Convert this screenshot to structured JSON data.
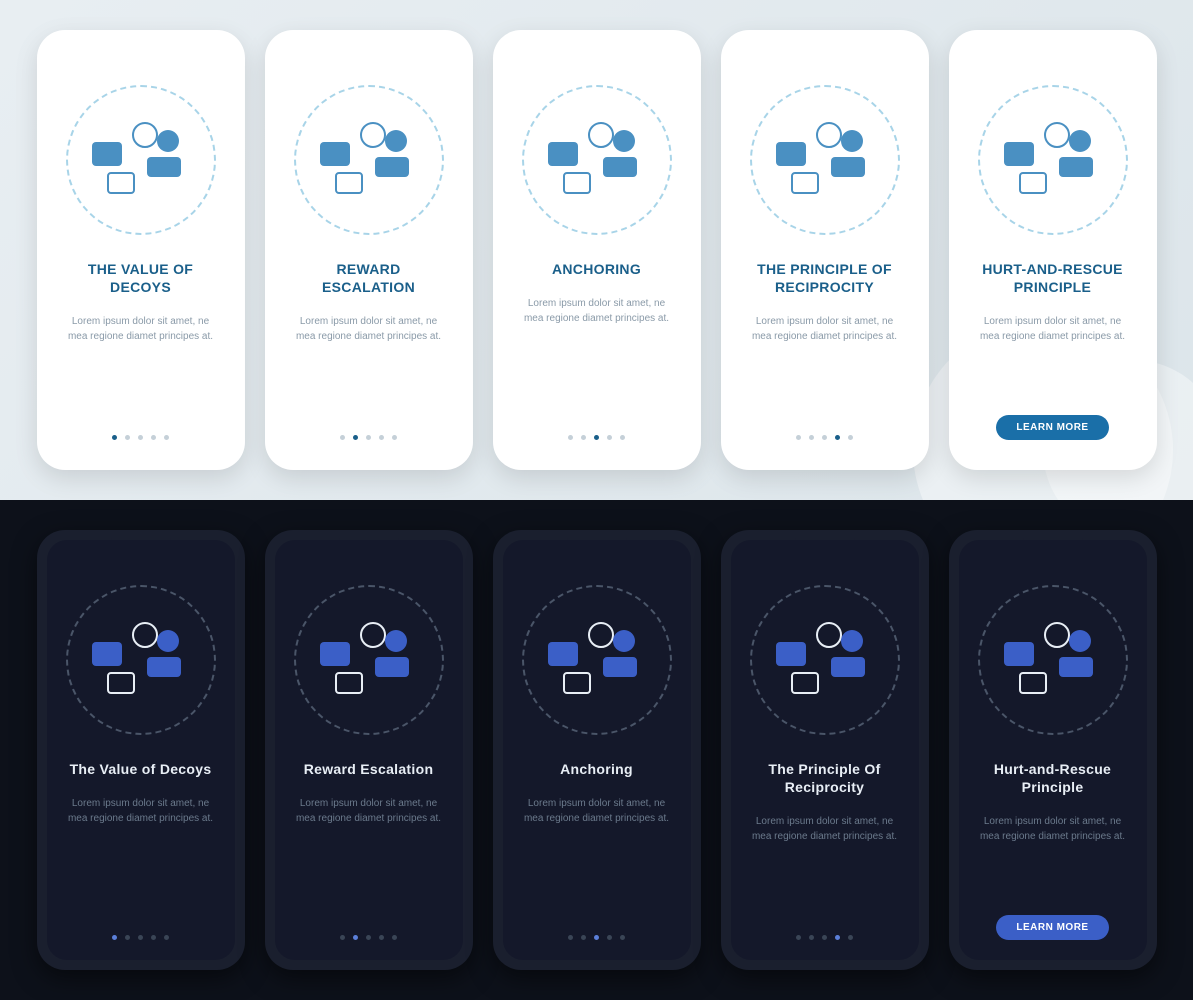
{
  "light": {
    "screens": [
      {
        "icon": "value-decoys-icon",
        "title": "THE VALUE OF DECOYS",
        "desc": "Lorem ipsum dolor sit amet, ne mea regione diamet principes at.",
        "activeIndex": 0,
        "hasButton": false
      },
      {
        "icon": "reward-escalation-icon",
        "title": "REWARD ESCALATION",
        "desc": "Lorem ipsum dolor sit amet, ne mea regione diamet principes at.",
        "activeIndex": 1,
        "hasButton": false
      },
      {
        "icon": "anchoring-icon",
        "title": "ANCHORING",
        "desc": "Lorem ipsum dolor sit amet, ne mea regione diamet principes at.",
        "activeIndex": 2,
        "hasButton": false
      },
      {
        "icon": "reciprocity-icon",
        "title": "THE PRINCIPLE OF RECIPROCITY",
        "desc": "Lorem ipsum dolor sit amet, ne mea regione diamet principes at.",
        "activeIndex": 3,
        "hasButton": false
      },
      {
        "icon": "hurt-rescue-icon",
        "title": "HURT-AND-RESCUE PRINCIPLE",
        "desc": "Lorem ipsum dolor sit amet, ne mea regione diamet principes at.",
        "activeIndex": -1,
        "hasButton": true,
        "buttonLabel": "LEARN MORE"
      }
    ]
  },
  "dark": {
    "screens": [
      {
        "icon": "value-decoys-icon",
        "title": "The Value of Decoys",
        "desc": "Lorem ipsum dolor sit amet, ne mea regione diamet principes at.",
        "activeIndex": 0,
        "hasButton": false
      },
      {
        "icon": "reward-escalation-icon",
        "title": "Reward Escalation",
        "desc": "Lorem ipsum dolor sit amet, ne mea regione diamet principes at.",
        "activeIndex": 1,
        "hasButton": false
      },
      {
        "icon": "anchoring-icon",
        "title": "Anchoring",
        "desc": "Lorem ipsum dolor sit amet, ne mea regione diamet principes at.",
        "activeIndex": 2,
        "hasButton": false
      },
      {
        "icon": "reciprocity-icon",
        "title": "The Principle Of Reciprocity",
        "desc": "Lorem ipsum dolor sit amet, ne mea regione diamet principes at.",
        "activeIndex": 3,
        "hasButton": false
      },
      {
        "icon": "hurt-rescue-icon",
        "title": "Hurt-and-Rescue Principle",
        "desc": "Lorem ipsum dolor sit amet, ne mea regione diamet principes at.",
        "activeIndex": -1,
        "hasButton": true,
        "buttonLabel": "LEARN MORE"
      }
    ]
  },
  "dotCount": 5
}
